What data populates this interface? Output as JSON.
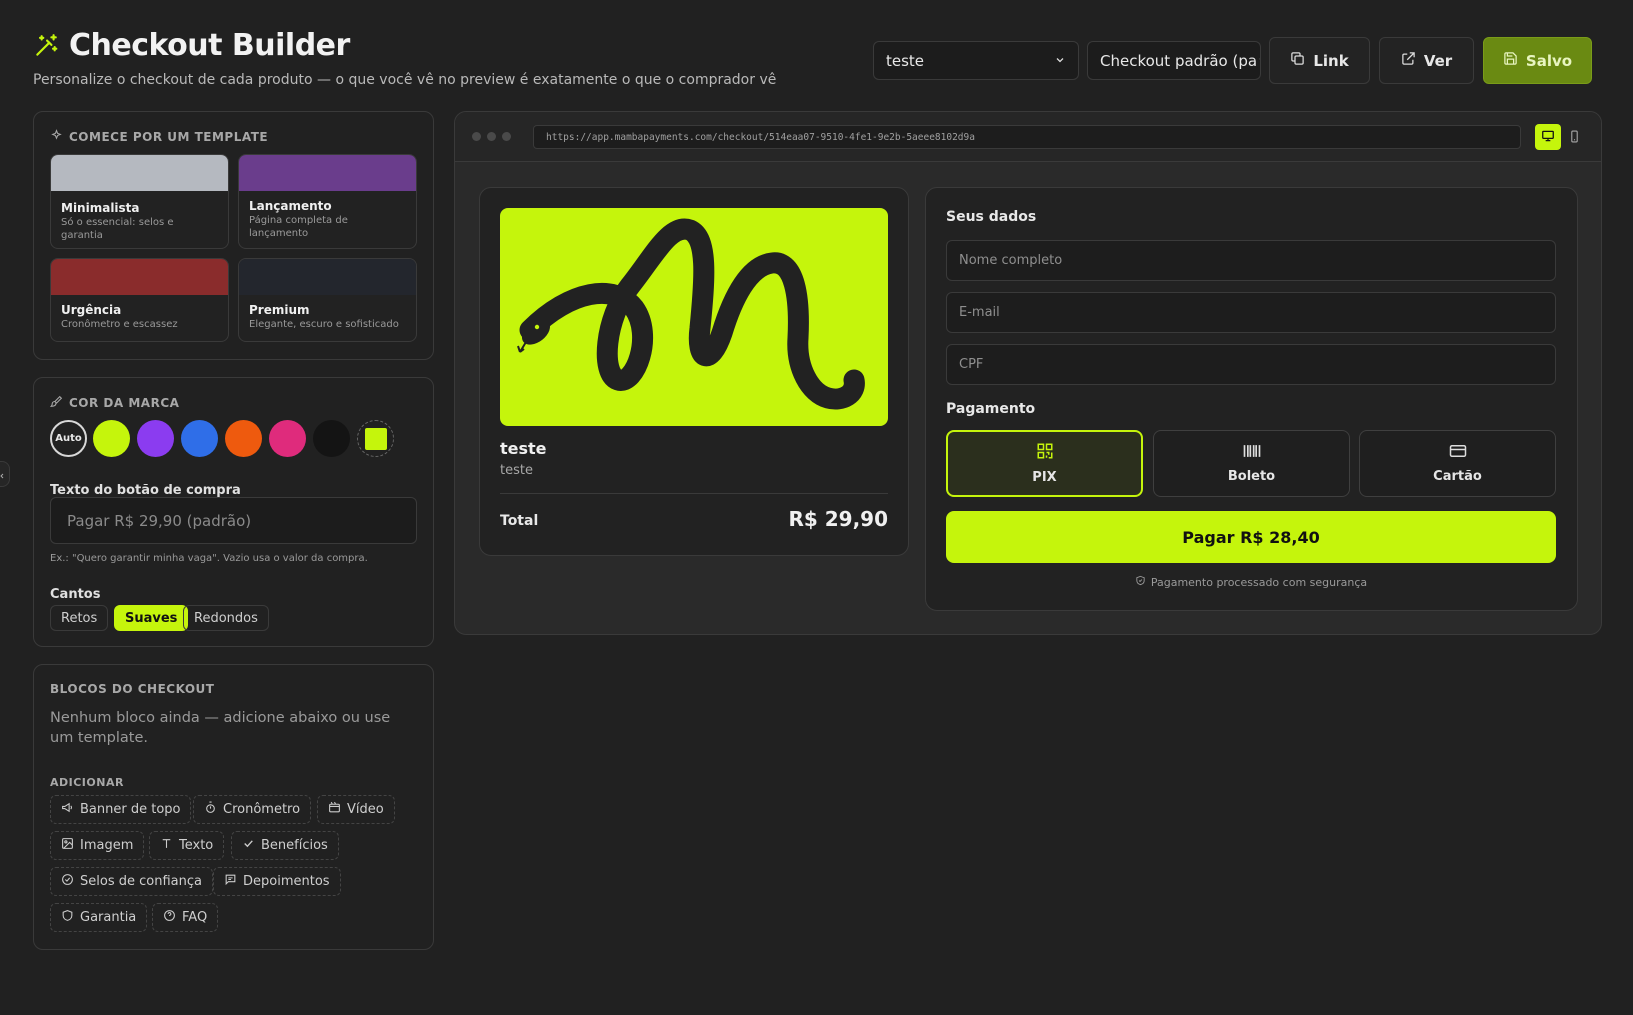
{
  "header": {
    "title": "Checkout Builder",
    "subtitle": "Personalize o checkout de cada produto — o que você vê no preview é exatamente o que o comprador vê",
    "product_select": "teste",
    "checkout_select": "Checkout padrão (pa",
    "link_label": "Link",
    "view_label": "Ver",
    "save_label": "Salvo"
  },
  "templates": {
    "heading": "COMECE POR UM TEMPLATE",
    "items": [
      {
        "name": "Minimalista",
        "desc": "Só o essencial: selos e garantia",
        "color": "#b5b9c0"
      },
      {
        "name": "Lançamento",
        "desc": "Página completa de lançamento",
        "color": "#6a3d8c"
      },
      {
        "name": "Urgência",
        "desc": "Cronômetro e escassez",
        "color": "#8a2c2c"
      },
      {
        "name": "Premium",
        "desc": "Elegante, escuro e sofisticado",
        "color": "#23262d"
      }
    ]
  },
  "brand": {
    "heading": "COR DA MARCA",
    "auto_label": "Auto",
    "colors": [
      "#c5f50c",
      "#8b3cf0",
      "#2f6ee8",
      "#ee5a0e",
      "#df2b7c",
      "#141414",
      "#c5f50c"
    ],
    "button_text_label": "Texto do botão de compra",
    "button_text_placeholder": "Pagar R$ 29,90 (padrão)",
    "button_hint": "Ex.: \"Quero garantir minha vaga\". Vazio usa o valor da compra.",
    "corners_label": "Cantos",
    "corners": [
      "Retos",
      "Suaves",
      "Redondos"
    ],
    "corners_selected": "Suaves"
  },
  "blocks": {
    "heading": "BLOCOS DO CHECKOUT",
    "empty": "Nenhum bloco ainda — adicione abaixo ou use um template.",
    "add_heading": "ADICIONAR",
    "chips": [
      {
        "label": "Banner de topo",
        "icon": "megaphone-icon"
      },
      {
        "label": "Cronômetro",
        "icon": "timer-icon"
      },
      {
        "label": "Vídeo",
        "icon": "video-icon"
      },
      {
        "label": "Imagem",
        "icon": "image-icon"
      },
      {
        "label": "Texto",
        "icon": "text-icon"
      },
      {
        "label": "Benefícios",
        "icon": "check-icon"
      },
      {
        "label": "Selos de confiança",
        "icon": "badge-check-icon"
      },
      {
        "label": "Depoimentos",
        "icon": "message-icon"
      },
      {
        "label": "Garantia",
        "icon": "shield-icon"
      },
      {
        "label": "FAQ",
        "icon": "help-icon"
      }
    ]
  },
  "preview": {
    "url": "https://app.mambapayments.com/checkout/514eaa07-9510-4fe1-9e2b-5aeee8102d9a",
    "product": {
      "name": "teste",
      "desc": "teste",
      "total_label": "Total",
      "total": "R$ 29,90"
    },
    "form": {
      "heading": "Seus dados",
      "name_ph": "Nome completo",
      "email_ph": "E-mail",
      "cpf_ph": "CPF"
    },
    "payment": {
      "heading": "Pagamento",
      "methods": [
        "PIX",
        "Boleto",
        "Cartão"
      ],
      "selected": "PIX"
    },
    "pay_button": "Pagar R$ 28,40",
    "secure_note": "Pagamento processado com segurança"
  },
  "accent": "#c5f50c"
}
